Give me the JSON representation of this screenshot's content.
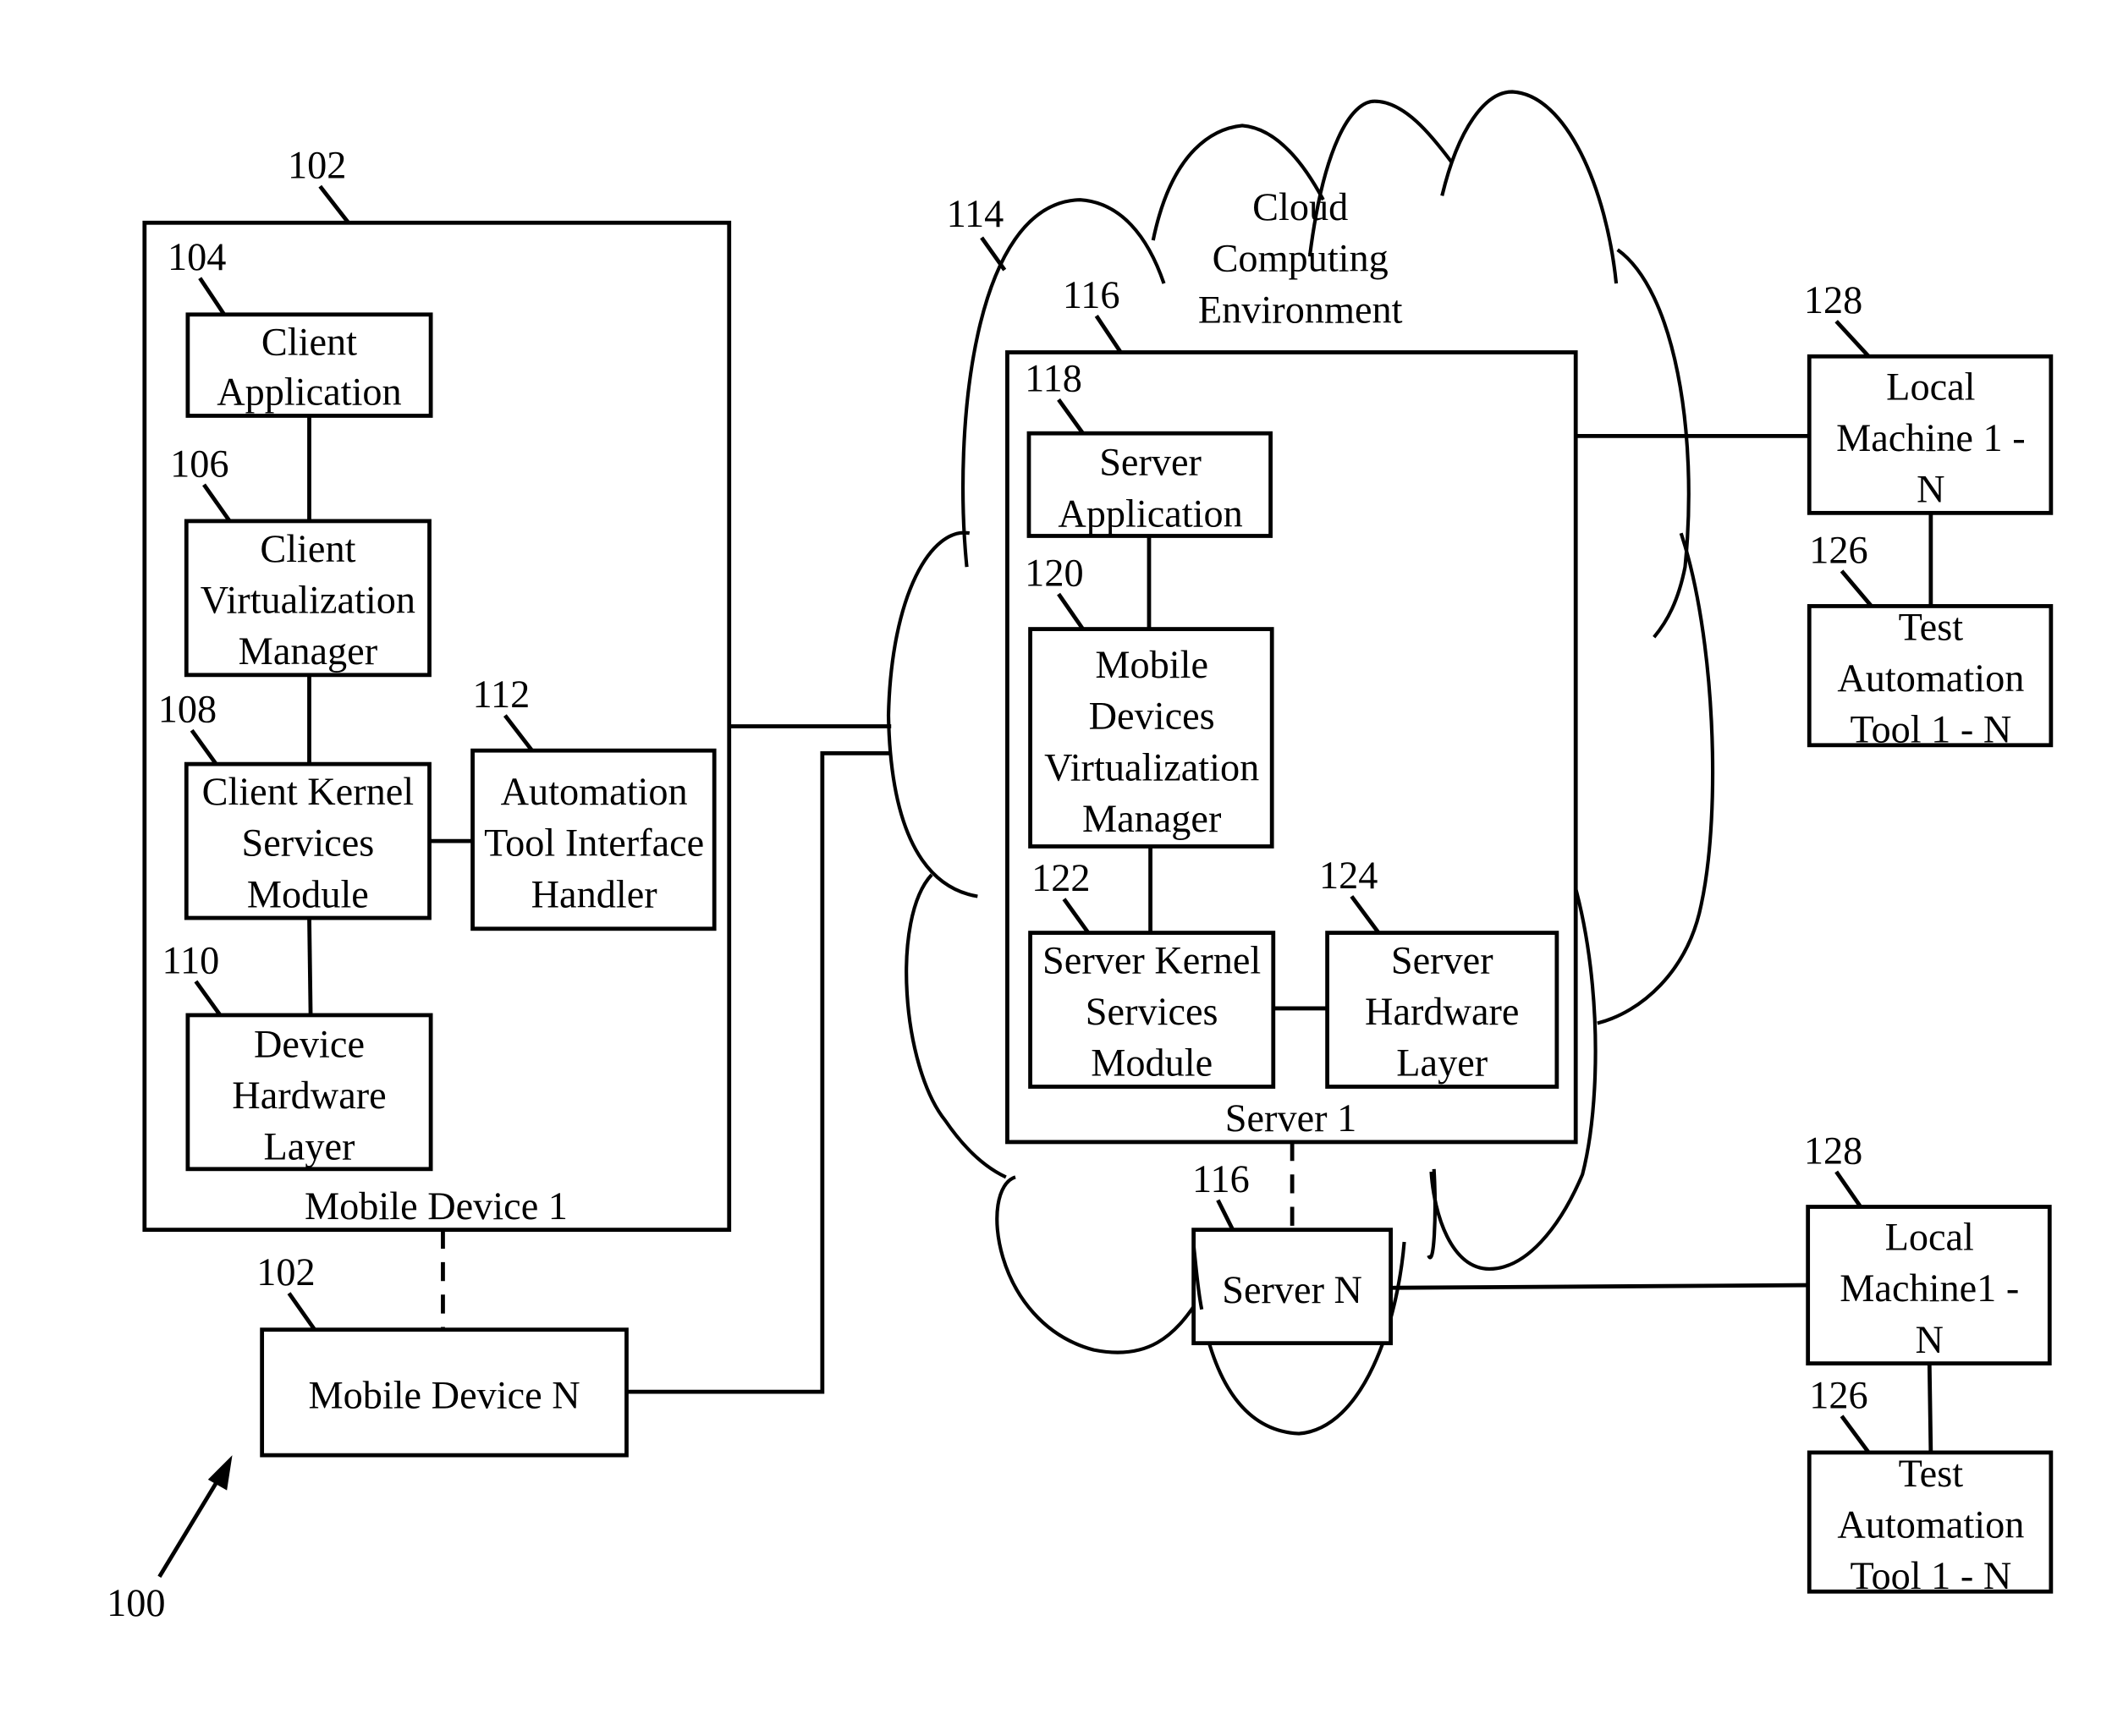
{
  "figure": {
    "ref": "100",
    "cloud": {
      "ref": "114",
      "label": [
        "Cloud",
        "Computing",
        "Environment"
      ]
    },
    "mobile_device_1": {
      "ref": "102",
      "label": "Mobile Device 1",
      "client_application": {
        "ref": "104",
        "label": [
          "Client",
          "Application"
        ]
      },
      "client_virtualization_manager": {
        "ref": "106",
        "label": [
          "Client",
          "Virtualization",
          "Manager"
        ]
      },
      "client_kernel_services_module": {
        "ref": "108",
        "label": [
          "Client Kernel",
          "Services",
          "Module"
        ]
      },
      "device_hardware_layer": {
        "ref": "110",
        "label": [
          "Device",
          "Hardware",
          "Layer"
        ]
      },
      "automation_tool_interface_handler": {
        "ref": "112",
        "label": [
          "Automation",
          "Tool Interface",
          "Handler"
        ]
      }
    },
    "mobile_device_n": {
      "ref": "102",
      "label": "Mobile Device N"
    },
    "server_1": {
      "ref": "116",
      "label": "Server 1",
      "server_application": {
        "ref": "118",
        "label": [
          "Server",
          "Application"
        ]
      },
      "mobile_devices_virtualization_manager": {
        "ref": "120",
        "label": [
          "Mobile",
          "Devices",
          "Virtualization",
          "Manager"
        ]
      },
      "server_kernel_services_module": {
        "ref": "122",
        "label": [
          "Server Kernel",
          "Services",
          "Module"
        ]
      },
      "server_hardware_layer": {
        "ref": "124",
        "label": [
          "Server",
          "Hardware",
          "Layer"
        ]
      }
    },
    "server_n": {
      "ref": "116",
      "label": "Server N"
    },
    "local_machine_top": {
      "ref": "128",
      "label": [
        "Local",
        "Machine 1 -",
        "N"
      ]
    },
    "test_tool_top": {
      "ref": "126",
      "label": [
        "Test",
        "Automation",
        "Tool 1 - N"
      ]
    },
    "local_machine_bottom": {
      "ref": "128",
      "label": [
        "Local",
        "Machine1  -",
        "N"
      ]
    },
    "test_tool_bottom": {
      "ref": "126",
      "label": [
        "Test",
        "Automation",
        "Tool 1 - N"
      ]
    }
  }
}
